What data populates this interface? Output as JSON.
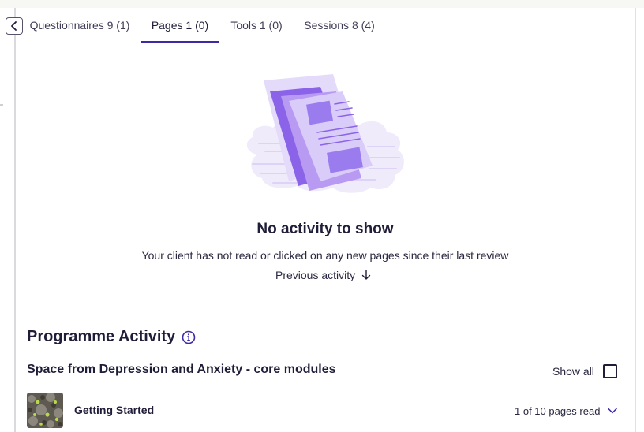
{
  "tabs": [
    {
      "label": "Questionnaires 9 (1)",
      "active": false
    },
    {
      "label": "Pages 1 (0)",
      "active": true
    },
    {
      "label": "Tools 1 (0)",
      "active": false
    },
    {
      "label": "Sessions 8 (4)",
      "active": false
    }
  ],
  "empty_state": {
    "title": "No activity to show",
    "description": "Your client has not read or clicked on any new pages since their last review",
    "previous_activity_label": "Previous activity",
    "illustration_icon": "documents-illustration"
  },
  "programme_activity": {
    "title": "Programme Activity",
    "programme_name": "Space from Depression and Anxiety - core modules",
    "show_all_label": "Show all",
    "show_all_checked": false,
    "modules": [
      {
        "name": "Getting Started",
        "progress": "1 of 10 pages read"
      }
    ]
  },
  "colors": {
    "accent": "#3b2aa6",
    "text": "#1f1d38",
    "illustration_purple": "#8b63e8"
  }
}
